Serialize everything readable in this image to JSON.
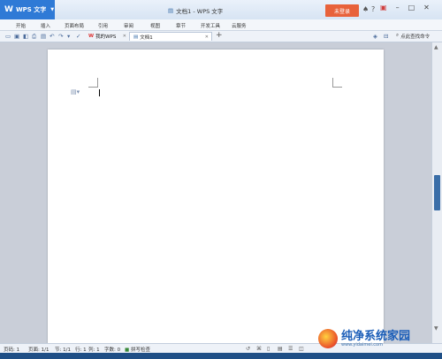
{
  "titlebar": {
    "app_menu": "WPS 文字",
    "doc_title": "文档1 - WPS 文字",
    "login_button": "未登录",
    "icons": [
      "shirt-icon",
      "help-icon",
      "menu-icon",
      "skin-icon"
    ]
  },
  "menu_tabs": [
    "开始",
    "插入",
    "页面布局",
    "引用",
    "审阅",
    "视图",
    "章节",
    "开发工具",
    "云服务"
  ],
  "doc_tabs": {
    "mywps": "我的WPS",
    "doc1": "文档1",
    "new_tab": "+"
  },
  "search": {
    "label": "点此查找命令"
  },
  "status": {
    "page_num": "页码: 1",
    "pages": "页面: 1/1",
    "section": "节: 1/1",
    "row": "行: 1",
    "col": "列: 1",
    "words": "字数: 0",
    "spell": "拼写检查"
  },
  "watermark": {
    "text": "纯净系统家园",
    "url": "www.yidaimei.com"
  },
  "colors": {
    "accent": "#2f7ad6",
    "login": "#e8623b",
    "desktop": "#1e5fa8"
  }
}
